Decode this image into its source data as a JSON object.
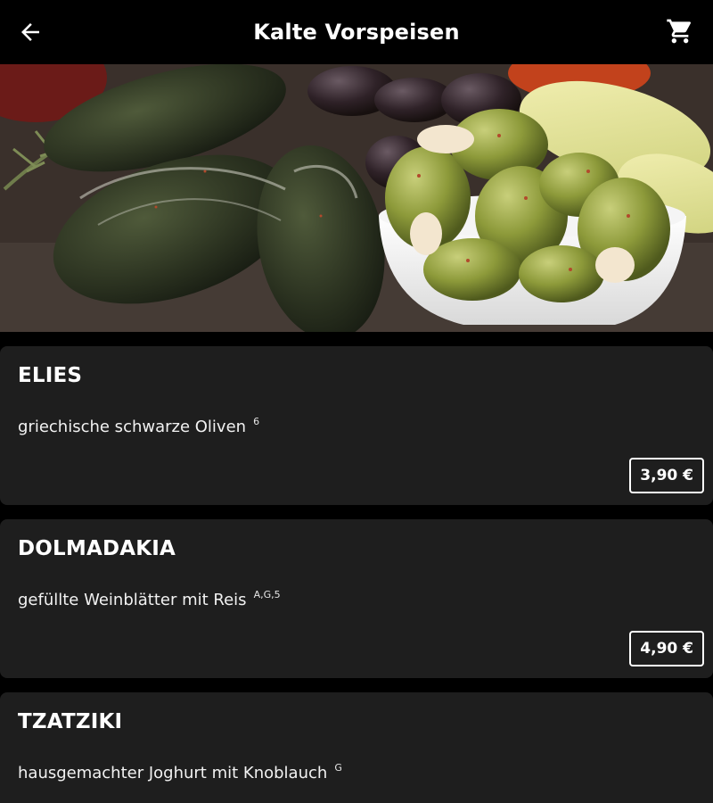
{
  "header": {
    "title": "Kalte Vorspeisen",
    "back_icon": "arrow-left-icon",
    "cart_icon": "shopping-cart-icon"
  },
  "hero": {
    "image": "food-banner-olives-dolmadakia"
  },
  "items": [
    {
      "name": "ELIES",
      "description": "griechische schwarze Oliven",
      "allergens": "6",
      "price": "3,90 €"
    },
    {
      "name": "DOLMADAKIA",
      "description": "gefüllte Weinblätter mit Reis",
      "allergens": "A,G,5",
      "price": "4,90 €"
    },
    {
      "name": "TZATZIKI",
      "description": "hausgemachter Joghurt mit Knoblauch",
      "allergens": "G"
    }
  ],
  "colors": {
    "background": "#000000",
    "card": "#1e1e1e",
    "text": "#ffffff"
  }
}
